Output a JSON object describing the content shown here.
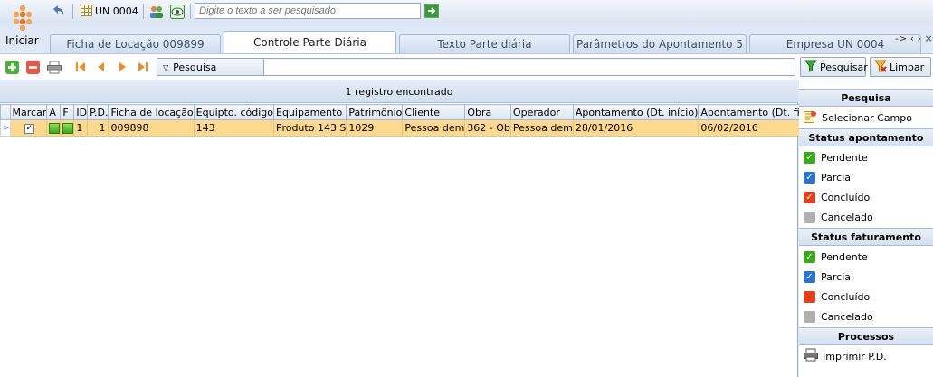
{
  "toolbar": {
    "un_label": "UN 0004",
    "search_placeholder": "Digite o texto a ser pesquisado"
  },
  "start": {
    "label": "Iniciar"
  },
  "tabs": [
    {
      "label": "Ficha de Locação 009899"
    },
    {
      "label": "Controle Parte Diária"
    },
    {
      "label": "Texto Parte diária"
    },
    {
      "label": "Parâmetros do Apontamento 5"
    },
    {
      "label": "Empresa UN 0004"
    }
  ],
  "tab_nav": "-> ‹ › ×",
  "actions": {
    "filter_dropdown": "Pesquisa",
    "search_button": "Pesquisar",
    "clear_button": "Limpar"
  },
  "grid": {
    "found_text": "1 registro encontrado",
    "columns": [
      "Marcar",
      "A",
      "F",
      "ID",
      "P.D.",
      "Ficha de locação",
      "Equipto. código",
      "Equipamento",
      "Patrimônio",
      "Cliente",
      "Obra",
      "Operador",
      "Apontamento (Dt. início)",
      "Apontamento (Dt. fim)"
    ],
    "rows": [
      {
        "marcar": true,
        "id": "1",
        "pd": "1",
        "ficha": "009898",
        "equip_codigo": "143",
        "equipamento": "Produto 143 S",
        "patrimonio": "1029",
        "cliente": "Pessoa dem",
        "obra": "362 - Ob",
        "operador": "Pessoa dem",
        "dt_inicio": "28/01/2016",
        "dt_fim": "06/02/2016"
      }
    ]
  },
  "panel": {
    "pesquisa_title": "Pesquisa",
    "select_field": "Selecionar Campo",
    "status_apont_title": "Status apontamento",
    "status_apont": [
      "Pendente",
      "Parcial",
      "Concluído",
      "Cancelado"
    ],
    "status_fat_title": "Status faturamento",
    "status_fat": [
      "Pendente",
      "Parcial",
      "Concluído",
      "Cancelado"
    ],
    "processos_title": "Processos",
    "print_pd": "Imprimir P.D."
  },
  "colors": {
    "row_highlight": "#fcd98e",
    "status_green": "#39a81b",
    "status_blue": "#2b73d2",
    "status_red": "#e0401b",
    "status_gray": "#b0b0b0"
  }
}
